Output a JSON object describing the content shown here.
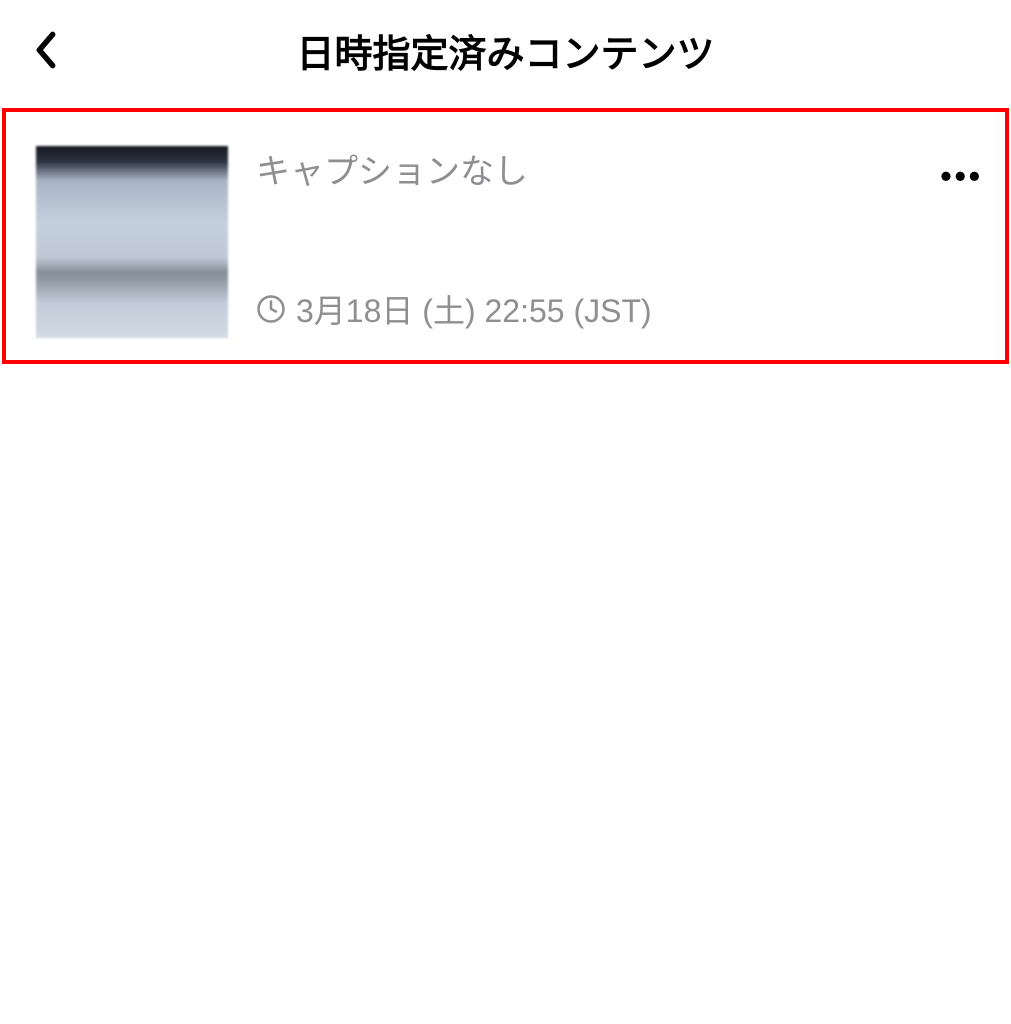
{
  "header": {
    "title": "日時指定済みコンテンツ"
  },
  "items": [
    {
      "caption": "キャプションなし",
      "schedule": "3月18日 (土) 22:55 (JST)"
    }
  ],
  "icons": {
    "back": "chevron-left-icon",
    "clock": "clock-icon",
    "more": "more-icon"
  }
}
